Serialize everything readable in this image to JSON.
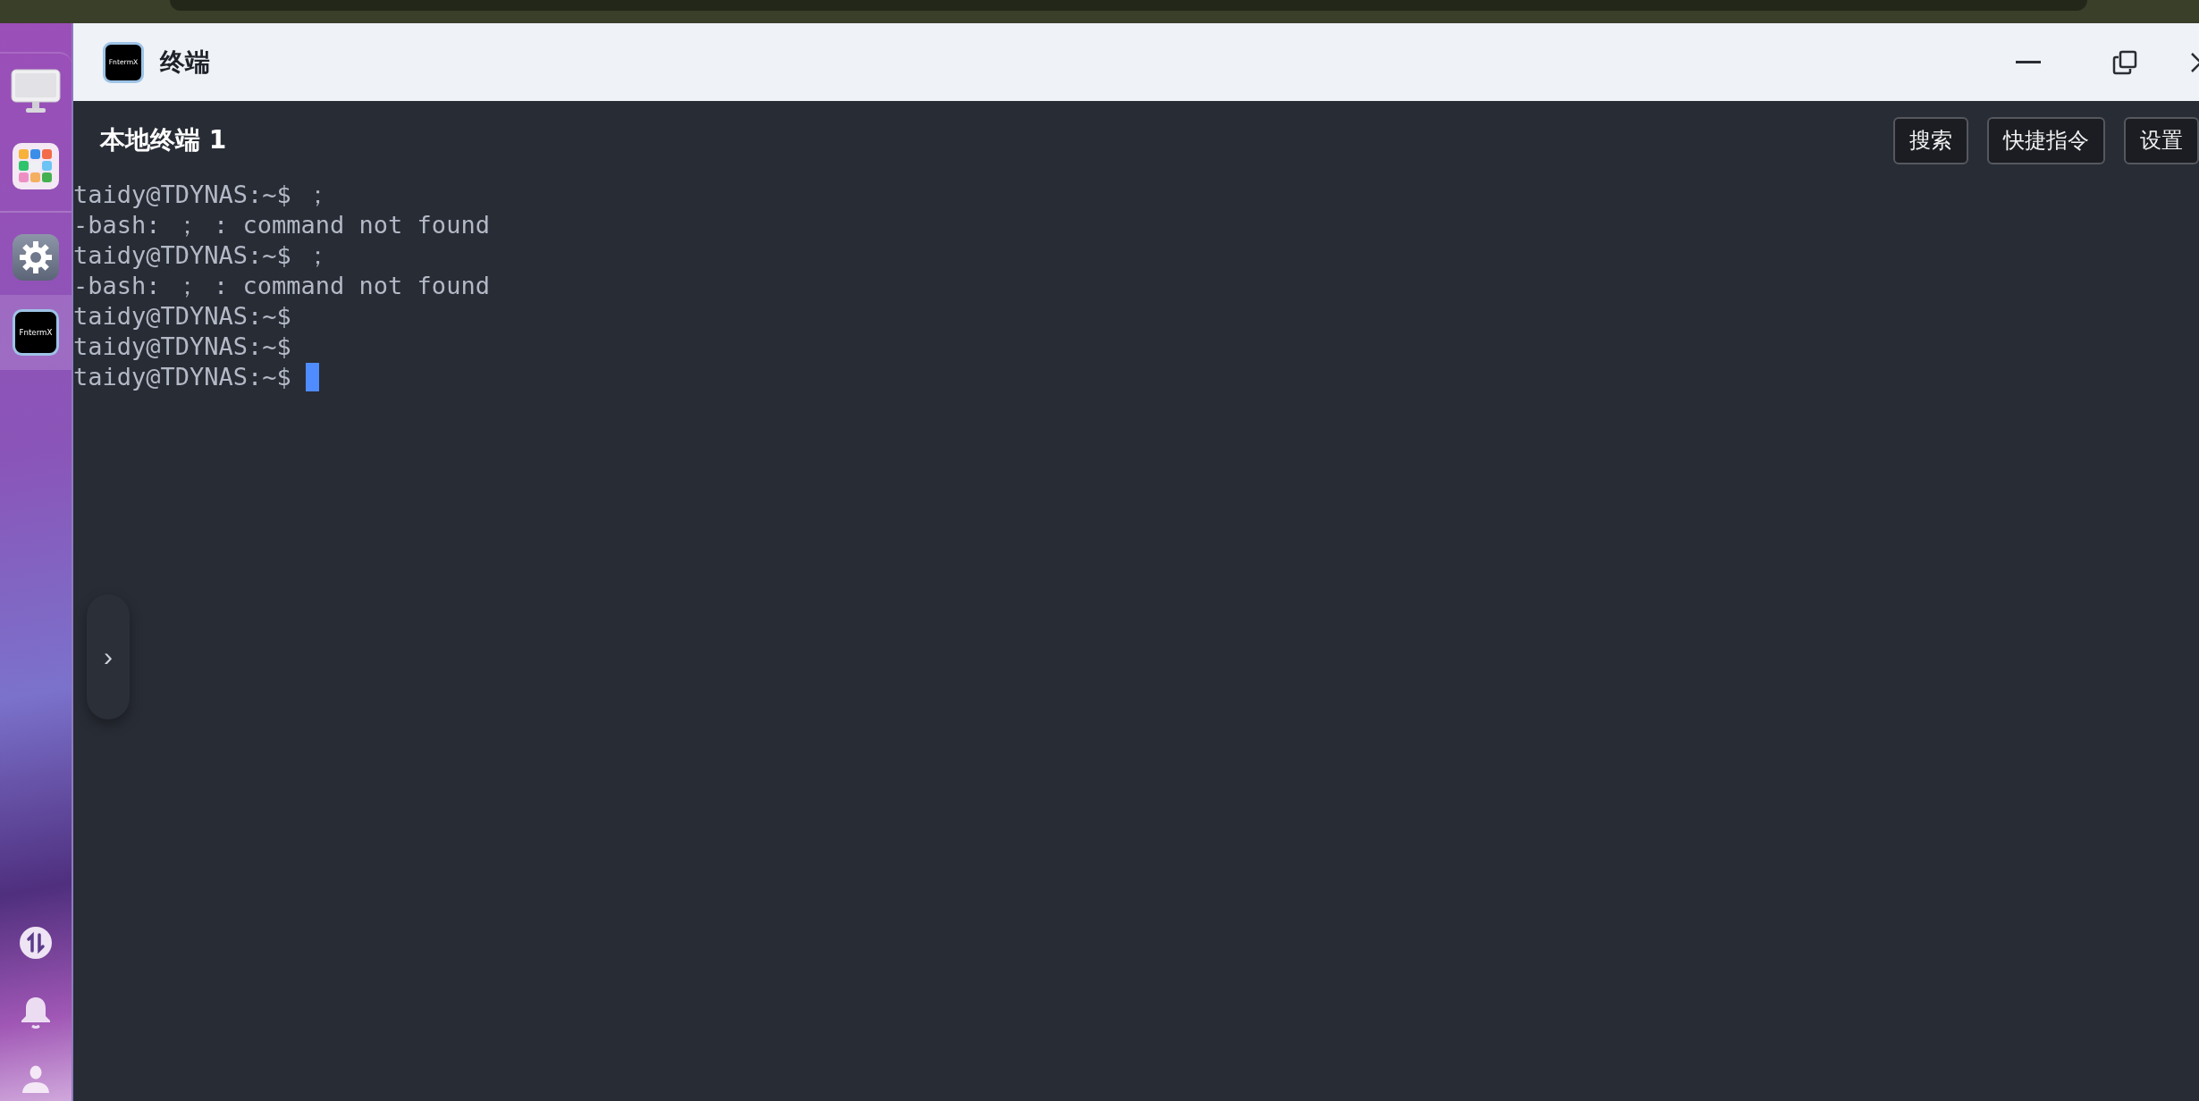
{
  "dock": {
    "items": [
      {
        "kind": "monitor",
        "selected": false
      },
      {
        "kind": "apps",
        "selected": false
      },
      {
        "kind": "settings",
        "selected": false
      },
      {
        "kind": "terminal",
        "label": "FntermX",
        "selected": true
      }
    ],
    "bottom_items": [
      {
        "kind": "transfer"
      },
      {
        "kind": "bell"
      },
      {
        "kind": "user"
      }
    ]
  },
  "window": {
    "title": "终端",
    "icon_label": "FntermX"
  },
  "terminal_tab": {
    "label": "本地终端 1"
  },
  "toolbar_buttons": [
    "搜索",
    "快捷指令",
    "设置"
  ],
  "terminal": {
    "lines": [
      "taidy@TDYNAS:~$ ；",
      "-bash: ； : command not found",
      "taidy@TDYNAS:~$ ；",
      "-bash: ； : command not found",
      "taidy@TDYNAS:~$",
      "taidy@TDYNAS:~$",
      "taidy@TDYNAS:~$ "
    ],
    "cursor": true
  },
  "side_handle": {
    "label": "›"
  }
}
